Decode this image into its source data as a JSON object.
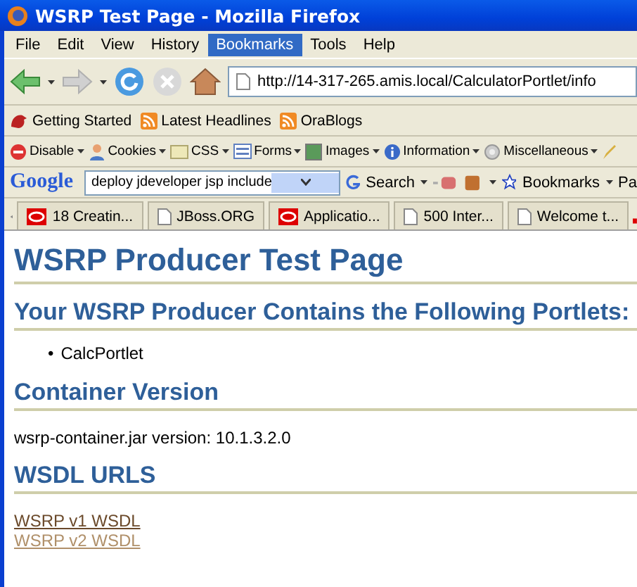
{
  "window": {
    "title": "WSRP Test Page - Mozilla Firefox"
  },
  "menu": [
    {
      "label": "File",
      "selected": false
    },
    {
      "label": "Edit",
      "selected": false
    },
    {
      "label": "View",
      "selected": false
    },
    {
      "label": "History",
      "selected": false
    },
    {
      "label": "Bookmarks",
      "selected": true
    },
    {
      "label": "Tools",
      "selected": false
    },
    {
      "label": "Help",
      "selected": false
    }
  ],
  "address_bar": {
    "value": "http://14-317-265.amis.local/CalculatorPortlet/info"
  },
  "bookmarks_bar": [
    {
      "label": "Getting Started",
      "kind": "page"
    },
    {
      "label": "Latest Headlines",
      "kind": "feed"
    },
    {
      "label": "OraBlogs",
      "kind": "feed"
    }
  ],
  "developer_toolbar": [
    {
      "label": "Disable",
      "kind": "disable"
    },
    {
      "label": "Cookies",
      "kind": "cookies"
    },
    {
      "label": "CSS",
      "kind": "css"
    },
    {
      "label": "Forms",
      "kind": "forms"
    },
    {
      "label": "Images",
      "kind": "images"
    },
    {
      "label": "Information",
      "kind": "info"
    },
    {
      "label": "Miscellaneous",
      "kind": "misc"
    }
  ],
  "google_toolbar": {
    "logo": "Google",
    "search_value": "deploy jdeveloper jsp include",
    "search_button": "Search",
    "bookmarks_button": "Bookmarks",
    "cut_label": "Pa"
  },
  "tabs": [
    {
      "label": "18 Creatin...",
      "kind": "oracle",
      "selected": false
    },
    {
      "label": "JBoss.ORG",
      "kind": "page",
      "selected": false
    },
    {
      "label": "Applicatio...",
      "kind": "oracle",
      "selected": false
    },
    {
      "label": "500 Inter...",
      "kind": "page",
      "selected": false
    },
    {
      "label": "Welcome t...",
      "kind": "page",
      "selected": false
    }
  ],
  "page": {
    "title": "WSRP Producer Test Page",
    "sections": [
      {
        "heading": "Your WSRP Producer Contains the Following Portlets:",
        "kind": "list",
        "items": [
          {
            "marker": "•",
            "label": "CalcPortlet"
          }
        ]
      },
      {
        "heading": "Container Version",
        "kind": "text",
        "text": "wsrp-container.jar version: 10.1.3.2.0"
      },
      {
        "heading": "WSDL URLS",
        "kind": "links",
        "links": [
          {
            "label": "WSRP v1 WSDL",
            "visited": false
          },
          {
            "label": "WSRP v2 WSDL",
            "visited": true
          }
        ]
      }
    ]
  }
}
